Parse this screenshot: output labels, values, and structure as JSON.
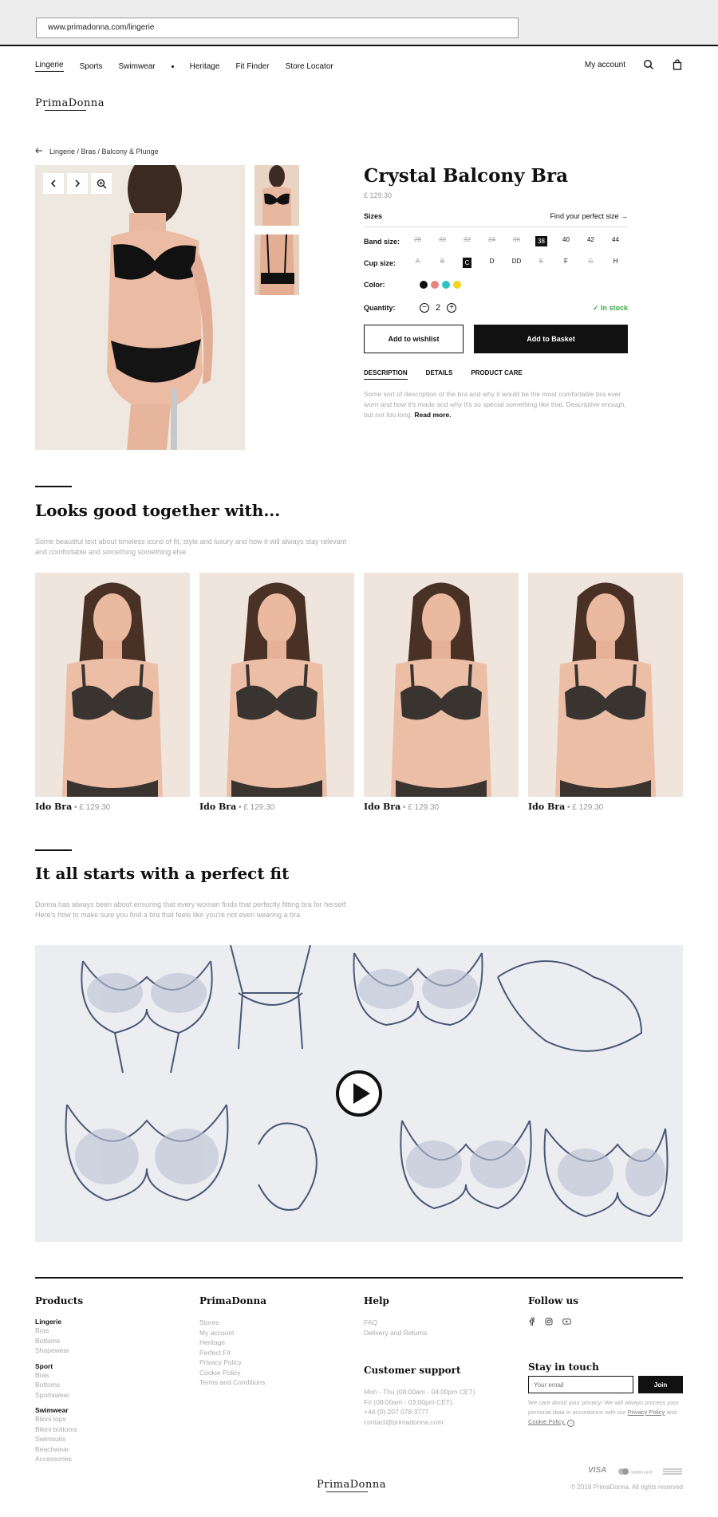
{
  "browser": {
    "url": "www.primadonna.com/lingerie"
  },
  "nav": {
    "items": [
      "Lingerie",
      "Sports",
      "Swimwear",
      "Heritage",
      "Fit Finder",
      "Store Locator"
    ],
    "account": "My account"
  },
  "brand": {
    "logo": "PrimaDonna"
  },
  "breadcrumb": "Lingerie / Bras / Balcony & Plunge",
  "product": {
    "title": "Crystal Balcony Bra",
    "price": "£ 129.30",
    "sizes_label": "Sizes",
    "find_size": "Find your perfect size",
    "band_label": "Band size:",
    "band_sizes": [
      {
        "v": "28",
        "state": "na"
      },
      {
        "v": "30",
        "state": "na"
      },
      {
        "v": "32",
        "state": "na"
      },
      {
        "v": "34",
        "state": "na"
      },
      {
        "v": "36",
        "state": "na"
      },
      {
        "v": "38",
        "state": "sel"
      },
      {
        "v": "40",
        "state": "ok"
      },
      {
        "v": "42",
        "state": "ok"
      },
      {
        "v": "44",
        "state": "ok"
      }
    ],
    "cup_label": "Cup size:",
    "cup_sizes": [
      {
        "v": "A",
        "state": "na"
      },
      {
        "v": "B",
        "state": "na"
      },
      {
        "v": "C",
        "state": "sel"
      },
      {
        "v": "D",
        "state": "ok"
      },
      {
        "v": "DD",
        "state": "ok"
      },
      {
        "v": "E",
        "state": "na"
      },
      {
        "v": "F",
        "state": "ok"
      },
      {
        "v": "G",
        "state": "na"
      },
      {
        "v": "H",
        "state": "ok"
      }
    ],
    "color_label": "Color:",
    "colors": [
      "#111111",
      "#e8827f",
      "#2ec4c4",
      "#f2d623"
    ],
    "quantity_label": "Quantity:",
    "quantity": "2",
    "stock": "In stock",
    "wishlist": "Add to wishlist",
    "basket": "Add to Basket",
    "tabs": [
      "DESCRIPTION",
      "DETAILS",
      "PRODUCT CARE"
    ],
    "description": "Some sort of description of the bra and why it would be the most comfortable bra ever worn and how it's made and why it's so special something like that. Descriptive enough, but not too long.",
    "read_more": "Read more."
  },
  "related": {
    "title": "Looks good together with...",
    "text": "Some beautiful text about timeless icons of fit, style and luxury and how it will always stay relevant and comfortable and something something else.",
    "items": [
      {
        "name": "Ido Bra",
        "price": "£ 129.30"
      },
      {
        "name": "Ido Bra",
        "price": "£ 129.30"
      },
      {
        "name": "Ido Bra",
        "price": "£ 129.30"
      },
      {
        "name": "Ido Bra",
        "price": "£ 129.30"
      }
    ]
  },
  "fit": {
    "title": "It all starts with a perfect fit",
    "text": "Donna has always been about ensuring that every woman finds that perfectly fitting bra for herself. Here's how to make sure you find a bra that feels like you're not even wearing a bra."
  },
  "footer": {
    "products": {
      "title": "Products",
      "groups": [
        {
          "name": "Lingerie",
          "links": [
            "Bras",
            "Bottoms",
            "Shapewear"
          ]
        },
        {
          "name": "Sport",
          "links": [
            "Bras",
            "Bottoms",
            "Sportswear"
          ]
        },
        {
          "name": "Swimwear",
          "links": [
            "Bikini tops",
            "Bikini bottoms",
            "Swimsuits",
            "Beachwear",
            "Accessories"
          ]
        }
      ]
    },
    "brand": {
      "title": "PrimaDonna",
      "links": [
        "Stores",
        "My account",
        "Heritage",
        "Perfect Fit",
        "Privacy Policy",
        "Cookie Policy",
        "Terms and Conditions"
      ]
    },
    "help": {
      "title": "Help",
      "links": [
        "FAQ",
        "Delivery and Returns"
      ]
    },
    "support": {
      "title": "Customer support",
      "lines": [
        "Mon - Thu (08:00am - 04:00pm CET)",
        "Fri (08:00am - 03:00pm CET)",
        "+44 (0) 207 078 3777",
        "contact@primadonna.com"
      ]
    },
    "follow": {
      "title": "Follow us"
    },
    "newsletter": {
      "title": "Stay in touch",
      "placeholder": "Your email",
      "button": "Join",
      "privacy_prefix": "We care about your privacy! We will always process your personal data in accordance with our",
      "privacy_link": "Privacy Policy",
      "and": "and",
      "cookie_link": "Cookie Policy."
    },
    "payments": [
      "VISA",
      "mastercard"
    ],
    "logo": "PrimaDonna",
    "copyright": "© 2018 PrimaDonna. All rights reserved"
  }
}
